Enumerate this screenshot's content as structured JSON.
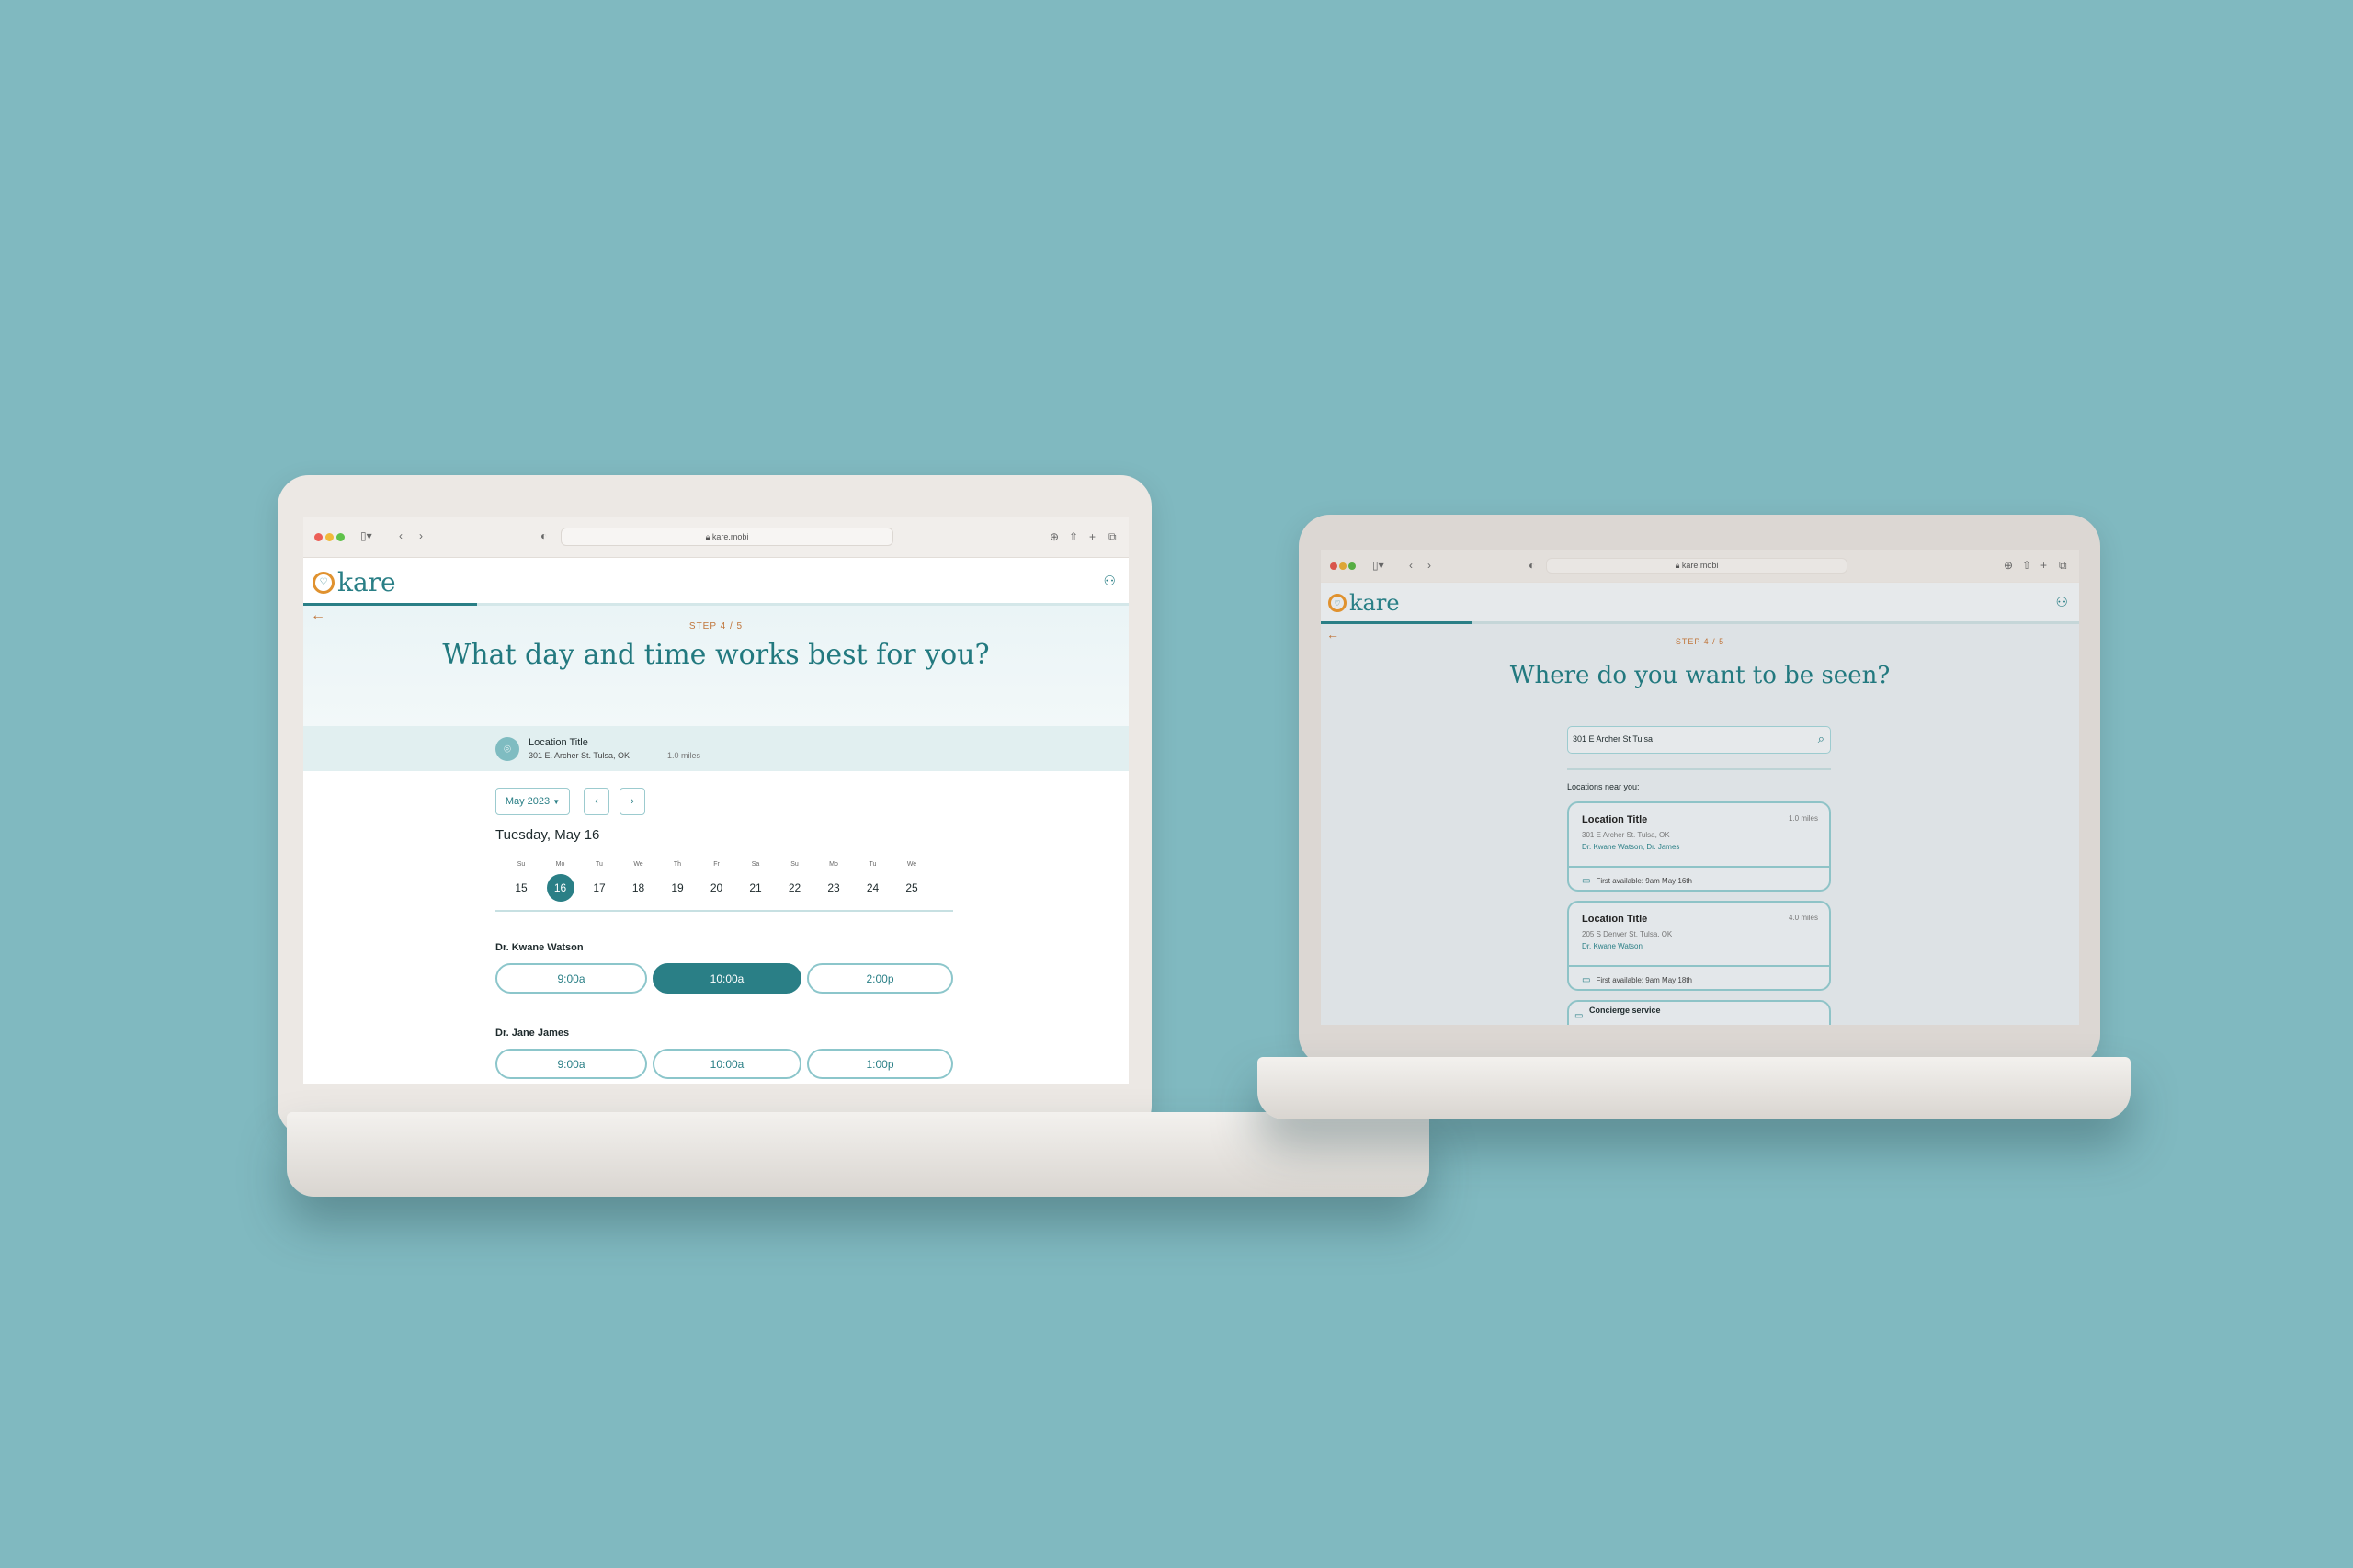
{
  "colors": {
    "background": "#80b9c0",
    "accent": "#2a7f86",
    "brand_orange": "#e0922f",
    "step": "#c0753a"
  },
  "browser": {
    "url": "kare.mobi",
    "icons": [
      "sidebar-icon",
      "back-icon",
      "forward-icon",
      "shield-icon",
      "lock-icon",
      "reload-icon",
      "download-icon",
      "share-icon",
      "new-tab-icon",
      "tabs-icon"
    ]
  },
  "brand": {
    "name": "kare"
  },
  "left": {
    "step": "STEP 4 / 5",
    "progress_percent": 21,
    "title": "What day and time works best for you?",
    "location": {
      "title": "Location Title",
      "address": "301 E. Archer St. Tulsa, OK",
      "distance": "1.0 miles"
    },
    "month": "May 2023",
    "date_heading": "Tuesday, May 16",
    "days": [
      {
        "l": "Su",
        "n": "15"
      },
      {
        "l": "Mo",
        "n": "16",
        "sel": true
      },
      {
        "l": "Tu",
        "n": "17"
      },
      {
        "l": "We",
        "n": "18"
      },
      {
        "l": "Th",
        "n": "19"
      },
      {
        "l": "Fr",
        "n": "20"
      },
      {
        "l": "Sa",
        "n": "21"
      },
      {
        "l": "Su",
        "n": "22"
      },
      {
        "l": "Mo",
        "n": "23"
      },
      {
        "l": "Tu",
        "n": "24"
      },
      {
        "l": "We",
        "n": "25"
      }
    ],
    "doctors": [
      {
        "name": "Dr. Kwane Watson",
        "slots": [
          "9:00a",
          "10:00a",
          "2:00p"
        ],
        "selected": 1
      },
      {
        "name": "Dr. Jane James",
        "slots": [
          "9:00a",
          "10:00a",
          "1:00p"
        ],
        "selected": -1
      }
    ]
  },
  "right": {
    "step": "STEP 4 / 5",
    "progress_percent": 20,
    "title": "Where do you want to be seen?",
    "search_value": "301 E Archer St Tulsa",
    "near_label": "Locations near you:",
    "cards": [
      {
        "title": "Location Title",
        "distance": "1.0 miles",
        "address": "301 E Archer St. Tulsa, OK",
        "doctors": "Dr. Kwane Watson, Dr. James",
        "first": "First available:  9am May 16th"
      },
      {
        "title": "Location Title",
        "distance": "4.0 miles",
        "address": "205 S Denver St. Tulsa, OK",
        "doctors": "Dr. Kwane Watson",
        "first": "First available:  9am May 18th"
      }
    ],
    "concierge": "Concierge service"
  }
}
